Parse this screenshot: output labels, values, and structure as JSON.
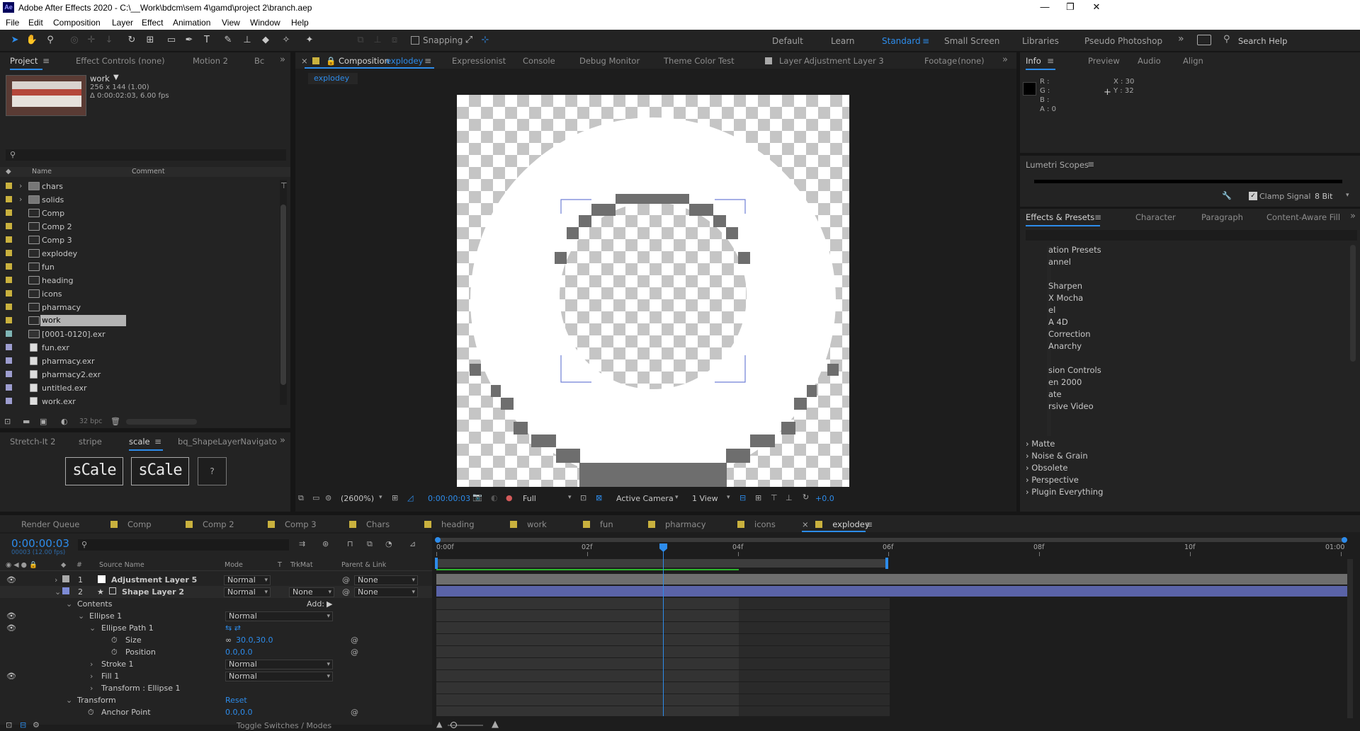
{
  "app": {
    "title": "Adobe After Effects 2020 - C:\\__Work\\bdcm\\sem 4\\gamd\\project 2\\branch.aep",
    "icon_text": "Ae",
    "window_controls": [
      "—",
      "❐",
      "✕"
    ]
  },
  "menu": [
    "File",
    "Edit",
    "Composition",
    "Layer",
    "Effect",
    "Animation",
    "View",
    "Window",
    "Help"
  ],
  "toolbar": {
    "snapping_label": "Snapping",
    "search_placeholder": "Search Help",
    "workspaces": [
      "Default",
      "Learn",
      "Standard",
      "Small Screen",
      "Libraries",
      "Pseudo Photoshop"
    ],
    "active_workspace": "Standard"
  },
  "project_panel": {
    "tabs": [
      "Project",
      "Effect Controls (none)",
      "Motion 2",
      "Bc"
    ],
    "selected": {
      "name": "work",
      "dims": "256 x 144 (1.00)",
      "duration": "Δ 0:00:02:03, 6.00 fps"
    },
    "search_placeholder": "",
    "columns": {
      "name": "Name",
      "comment": "Comment"
    },
    "items": [
      {
        "name": "chars",
        "type": "folder",
        "label": "#c9b13e"
      },
      {
        "name": "solids",
        "type": "folder",
        "label": "#c9b13e"
      },
      {
        "name": "Comp",
        "type": "comp",
        "label": "#c9b13e"
      },
      {
        "name": "Comp 2",
        "type": "comp",
        "label": "#c9b13e"
      },
      {
        "name": "Comp 3",
        "type": "comp",
        "label": "#c9b13e"
      },
      {
        "name": "explodey",
        "type": "comp",
        "label": "#c9b13e"
      },
      {
        "name": "fun",
        "type": "comp",
        "label": "#c9b13e"
      },
      {
        "name": "heading",
        "type": "comp",
        "label": "#c9b13e"
      },
      {
        "name": "icons",
        "type": "comp",
        "label": "#c9b13e"
      },
      {
        "name": "pharmacy",
        "type": "comp",
        "label": "#c9b13e"
      },
      {
        "name": "work",
        "type": "comp",
        "label": "#c9b13e",
        "selected": true
      },
      {
        "name": "[0001-0120].exr",
        "type": "seq",
        "label": "#7fb5b5"
      },
      {
        "name": "fun.exr",
        "type": "file",
        "label": "#9d9dcf"
      },
      {
        "name": "pharmacy.exr",
        "type": "file",
        "label": "#9d9dcf"
      },
      {
        "name": "pharmacy2.exr",
        "type": "file",
        "label": "#9d9dcf"
      },
      {
        "name": "untitled.exr",
        "type": "file",
        "label": "#9d9dcf"
      },
      {
        "name": "work.exr",
        "type": "file",
        "label": "#9d9dcf"
      }
    ],
    "bpc": "32 bpc"
  },
  "scale_panel": {
    "tabs": [
      "Stretch-It 2",
      "stripe",
      "scale",
      "bq_ShapeLayerNavigato"
    ],
    "buttons": [
      "sCale",
      "sCale",
      "?"
    ]
  },
  "comp_viewer": {
    "tabs": [
      "Composition",
      "explodey",
      "Expressionist",
      "Console",
      "Debug Monitor",
      "Theme Color Test",
      "Layer",
      "Adjustment Layer 3",
      "Footage",
      "(none)"
    ],
    "breadcrumb": "explodey",
    "footer": {
      "zoom": "(2600%)",
      "time": "0:00:00:03",
      "resolution": "Full",
      "camera": "Active Camera",
      "views": "1 View",
      "exposure": "+0.0"
    }
  },
  "info_panel": {
    "tabs": [
      "Info",
      "Preview",
      "Audio",
      "Align"
    ],
    "r": "R :",
    "g": "G :",
    "b": "B :",
    "a": "A :  0",
    "x": "X : 30",
    "y": "Y : 32"
  },
  "lumetri": {
    "title": "Lumetri Scopes",
    "clamp": "Clamp Signal",
    "bit": "8 Bit"
  },
  "effects_panel": {
    "tabs": [
      "Effects & Presets",
      "Character",
      "Paragraph",
      "Content-Aware Fill"
    ],
    "items": [
      "ation Presets",
      "annel",
      "",
      "Sharpen",
      "X Mocha",
      "el",
      "A 4D",
      "Correction",
      "Anarchy",
      "",
      "sion Controls",
      "en 2000",
      "ate",
      "rsive Video",
      "",
      ""
    ],
    "groups": [
      "Matte",
      "Noise & Grain",
      "Obsolete",
      "Perspective",
      "Plugin Everything"
    ]
  },
  "timeline": {
    "tabs": [
      {
        "name": "Render Queue",
        "color": ""
      },
      {
        "name": "Comp",
        "color": "#c9b13e"
      },
      {
        "name": "Comp 2",
        "color": "#c9b13e"
      },
      {
        "name": "Comp 3",
        "color": "#c9b13e"
      },
      {
        "name": "Chars",
        "color": "#c9b13e"
      },
      {
        "name": "heading",
        "color": "#c9b13e"
      },
      {
        "name": "work",
        "color": "#c9b13e"
      },
      {
        "name": "fun",
        "color": "#c9b13e"
      },
      {
        "name": "pharmacy",
        "color": "#c9b13e"
      },
      {
        "name": "icons",
        "color": "#c9b13e"
      },
      {
        "name": "explodey",
        "color": "#c9b13e",
        "active": true
      }
    ],
    "timecode": "0:00:00:03",
    "frames": "00003 (12.00 fps)",
    "headers": {
      "source": "Source Name",
      "mode": "Mode",
      "t": "T",
      "trkmat": "TrkMat",
      "parent": "Parent & Link"
    },
    "ruler": [
      "0:00f",
      "02f",
      "04f",
      "06f",
      "08f",
      "10f",
      "01:00"
    ],
    "layers": [
      {
        "num": "1",
        "name": "Adjustment Layer 5",
        "mode": "Normal",
        "trkmat": "",
        "parent": "None",
        "color": "#a9a9a9"
      },
      {
        "num": "2",
        "name": "Shape Layer 2",
        "mode": "Normal",
        "trkmat": "None",
        "parent": "None",
        "color": "#7d8bd6"
      }
    ],
    "props": {
      "contents": "Contents",
      "add": "Add:",
      "ellipse": "Ellipse 1",
      "ellipse_mode": "Normal",
      "path": "Ellipse Path 1",
      "size": "Size",
      "size_val": "30.0,30.0",
      "position": "Position",
      "position_val": "0.0,0.0",
      "stroke": "Stroke 1",
      "stroke_mode": "Normal",
      "fill": "Fill 1",
      "fill_mode": "Normal",
      "transform_ellipse": "Transform : Ellipse 1",
      "transform": "Transform",
      "reset": "Reset",
      "anchor": "Anchor Point",
      "anchor_val": "0.0,0.0"
    },
    "footer": "Toggle Switches / Modes"
  }
}
